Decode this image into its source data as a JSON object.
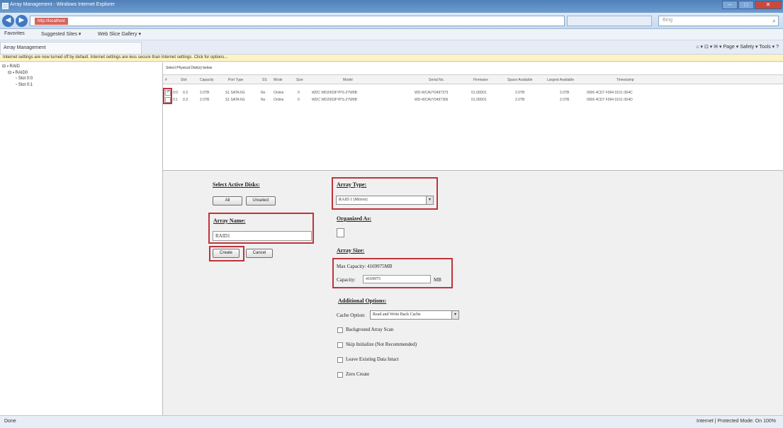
{
  "window": {
    "title": "Array Management - Windows Internet Explorer"
  },
  "navbar": {
    "address": "http://localhost",
    "search_placeholder": "Bing"
  },
  "favbar": {
    "favorites": "Favorites",
    "suggested": "Suggested Sites ▾",
    "slice": "Web Slice Gallery ▾"
  },
  "tab": {
    "label": "Array Management"
  },
  "commandbar": {
    "label": "⌂ ▾ ⊡ ▾ ✉ ▾ Page ▾ Safety ▾ Tools ▾ ?"
  },
  "infobar": {
    "text": "Internet settings are now turned off by default. Internet settings are less secure than Internet settings. Click for options..."
  },
  "tree": {
    "root": "RAID",
    "child": "RAID0",
    "items": [
      "Slot 0:0",
      "Slot 0:1"
    ]
  },
  "grid": {
    "caption": "Select Physical Disk(s) below",
    "headers": [
      "#",
      "Slot",
      "Capacity",
      "Port Type",
      "SS",
      "Mode",
      "Size",
      "Model",
      "Serial No.",
      "Firmware",
      "Space Available",
      "Largest Available",
      "Timestamp"
    ],
    "rows": [
      [
        "0:0",
        "0.3",
        "2.0TB",
        "S1 SATA 6G",
        "No",
        "Online",
        "0",
        "WDC WD2003FYPS-27W9B",
        "WD-WCAVY0497373",
        "01.00D01",
        "2.0TB",
        "2.0TB",
        "0006 4CD7 F094 0101 0D4C"
      ],
      [
        "0:1",
        "0.3",
        "2.0TB",
        "S1 SATA 6G",
        "No",
        "Online",
        "0",
        "WDC WD2003FYPS-27W9B",
        "WD-WCAVY0497356",
        "01.00D01",
        "2.0TB",
        "2.0TB",
        "0006 4CD7 F094 0101 0D4D"
      ]
    ]
  },
  "form": {
    "select_disks": {
      "heading": "Select Active Disks:",
      "all": "All",
      "unselect": "Unselect"
    },
    "array_name": {
      "heading": "Array Name:",
      "value": "RAID1"
    },
    "create": "Create",
    "cancel": "Cancel",
    "array_type": {
      "heading": "Array Type:",
      "value": "RAID 1 (Mirror)"
    },
    "organized_as": {
      "heading": "Organized As:"
    },
    "array_size": {
      "heading": "Array Size:",
      "max_capacity": "Max Capacity: 4169975MB",
      "capacity_label": "Capacity:",
      "capacity_value": "4169975",
      "unit": "MB"
    },
    "additional": {
      "heading": "Additional Options:",
      "cache_label": "Cache Option:",
      "cache_value": "Read and Write Back Cache",
      "options": [
        "Background Array Scan",
        "Skip Initialize (Not Recommended)",
        "Leave Existing Data Intact",
        "Zero Create"
      ]
    }
  },
  "status": {
    "left": "Done",
    "right": "Internet | Protected Mode: On   100%"
  }
}
